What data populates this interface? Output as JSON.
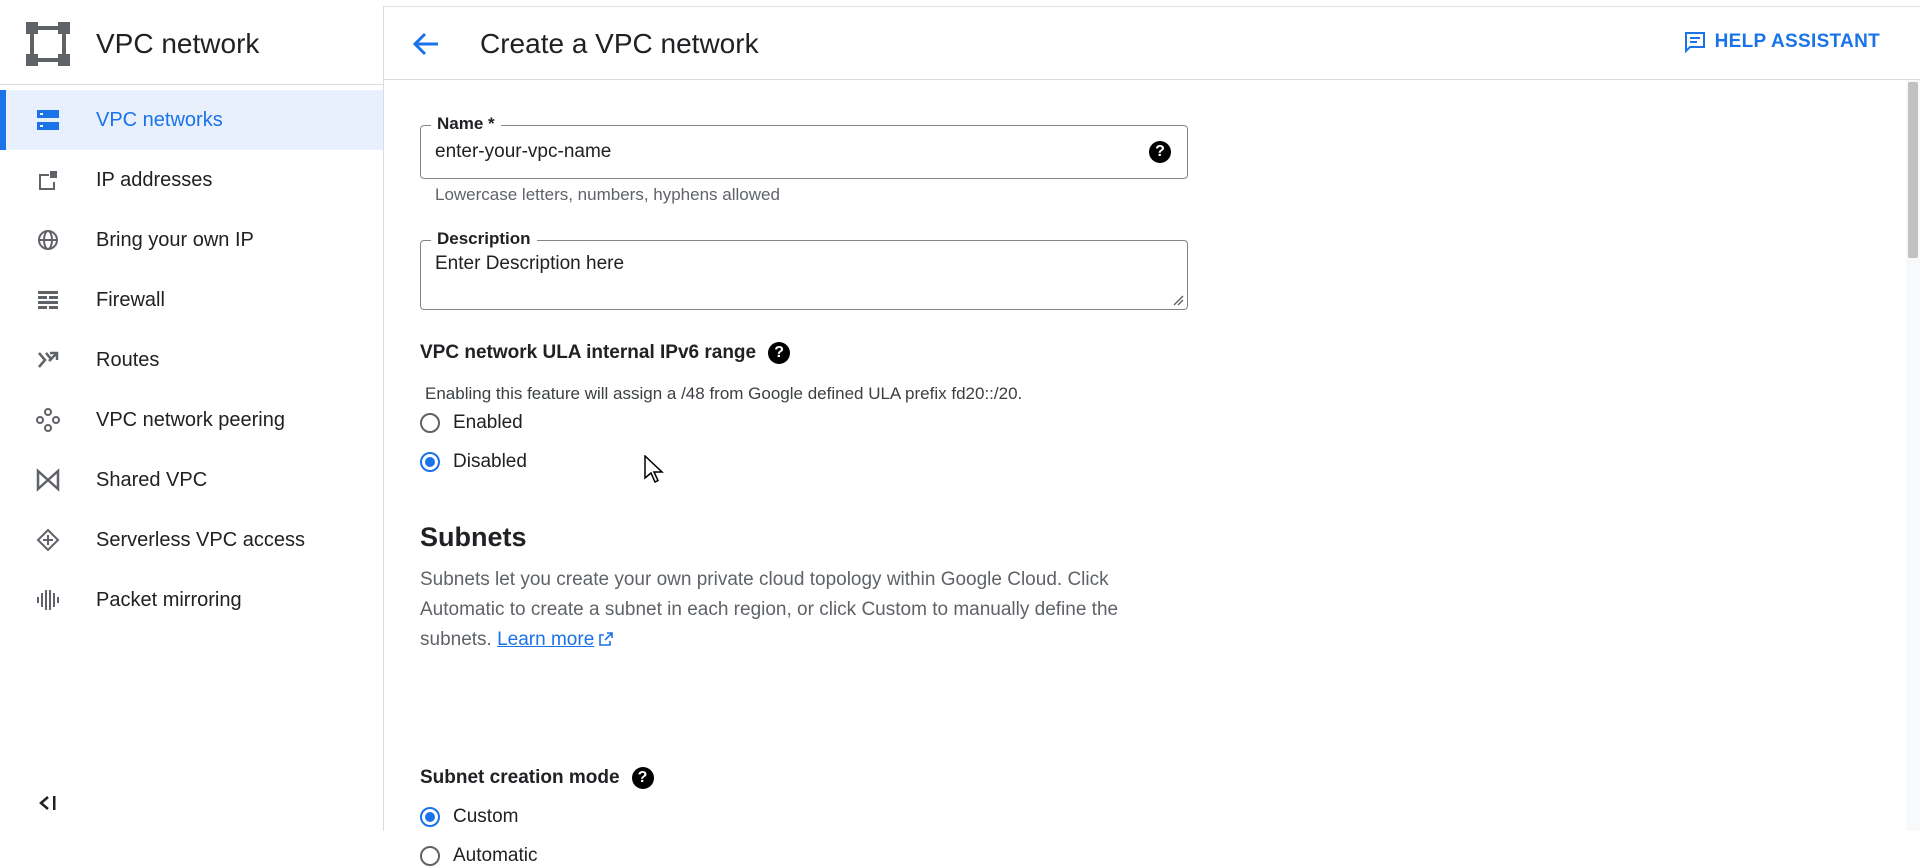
{
  "sidebar": {
    "title": "VPC network",
    "items": [
      {
        "label": "VPC networks",
        "icon": "vpc-networks-icon",
        "active": true
      },
      {
        "label": "IP addresses",
        "icon": "ip-addresses-icon"
      },
      {
        "label": "Bring your own IP",
        "icon": "globe-icon"
      },
      {
        "label": "Firewall",
        "icon": "firewall-icon"
      },
      {
        "label": "Routes",
        "icon": "routes-icon"
      },
      {
        "label": "VPC network peering",
        "icon": "peering-icon"
      },
      {
        "label": "Shared VPC",
        "icon": "shared-vpc-icon"
      },
      {
        "label": "Serverless VPC access",
        "icon": "serverless-icon"
      },
      {
        "label": "Packet mirroring",
        "icon": "packet-mirroring-icon"
      }
    ]
  },
  "header": {
    "title": "Create a VPC network",
    "help_label": "HELP ASSISTANT"
  },
  "form": {
    "name_label": "Name *",
    "name_value": "enter-your-vpc-name",
    "name_hint": "Lowercase letters, numbers, hyphens allowed",
    "description_label": "Description",
    "description_value": "Enter Description here",
    "ipv6_label": "VPC network ULA internal IPv6 range",
    "ipv6_desc": "Enabling this feature will assign a /48 from Google defined ULA prefix fd20::/20.",
    "ipv6_options": [
      {
        "label": "Enabled",
        "checked": false
      },
      {
        "label": "Disabled",
        "checked": true
      }
    ],
    "subnets_heading": "Subnets",
    "subnets_text": "Subnets let you create your own private cloud topology within Google Cloud. Click Automatic to create a subnet in each region, or click Custom to manually define the subnets.",
    "learn_more": "Learn more",
    "subnet_mode_label": "Subnet creation mode",
    "subnet_mode_options": [
      {
        "label": "Custom",
        "checked": true
      },
      {
        "label": "Automatic",
        "checked": false
      }
    ]
  },
  "colors": {
    "accent": "#1a73e8",
    "active_bg": "#e8f0fe"
  }
}
